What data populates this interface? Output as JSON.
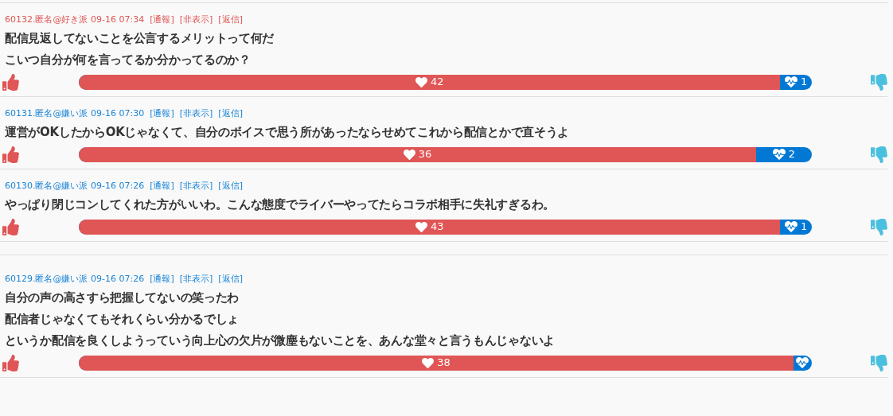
{
  "comments": [
    {
      "meta": "60132.匿名@好き派 09-16 07:34",
      "color": "#e05555",
      "actions": [
        "[通報]",
        "[非表示]",
        "[返信]"
      ],
      "lines": [
        "配信見返してないことを公言するメリットって何だ",
        "こいつ自分が何を言ってるか分かってるのか？"
      ],
      "likes": "42",
      "dislikes": "1",
      "level": 0.957
    },
    {
      "meta": "60131.匿名@嫌い派 09-16 07:30",
      "color": "#1a84d6",
      "actions": [
        "[通報]",
        "[非表示]",
        "[返信]"
      ],
      "lines": [
        "運営がOKしたからOKじゃなくて、自分のボイスで思う所があったならせめてこれから配信とかで直そうよ"
      ],
      "likes": "36",
      "dislikes": "2",
      "level": 0.924
    },
    {
      "meta": "60130.匿名@嫌い派 09-16 07:26",
      "color": "#1a84d6",
      "actions": [
        "[通報]",
        "[非表示]",
        "[返信]"
      ],
      "lines": [
        "やっぱり閉じコンしてくれた方がいいわ。こんな態度でライバーやってたらコラボ相手に失礼すぎるわ。"
      ],
      "likes": "43",
      "dislikes": "1",
      "level": 0.957
    },
    {
      "meta": "60129.匿名@嫌い派 09-16 07:26",
      "color": "#1a84d6",
      "actions": [
        "[通報]",
        "[非表示]",
        "[返信]"
      ],
      "lines": [
        "自分の声の高さすら把握してないの笑ったわ",
        "配信者じゃなくてもそれくらい分かるでしょ",
        "というか配信を良くしようっていう向上心の欠片が微塵もないことを、あんな堂々と言うもんじゃないよ"
      ],
      "likes": "38",
      "level": 0.975
    }
  ]
}
